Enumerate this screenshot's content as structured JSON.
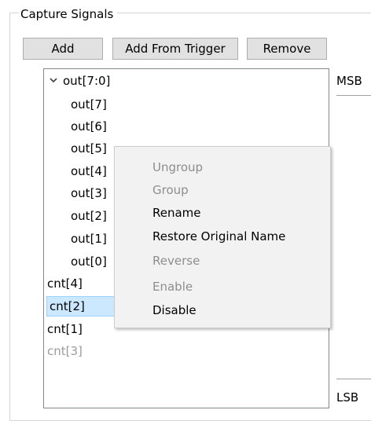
{
  "group": {
    "title": "Capture Signals"
  },
  "buttons": {
    "add": "Add",
    "add_from_trigger": "Add From Trigger",
    "remove": "Remove"
  },
  "tree": {
    "root": {
      "label": "out[7:0]",
      "expanded": true
    },
    "children": [
      {
        "label": "out[7]"
      },
      {
        "label": "out[6]"
      },
      {
        "label": "out[5]"
      },
      {
        "label": "out[4]"
      },
      {
        "label": "out[3]"
      },
      {
        "label": "out[2]"
      },
      {
        "label": "out[1]"
      },
      {
        "label": "out[0]"
      }
    ],
    "others": [
      {
        "label": "cnt[4]",
        "state": "normal"
      },
      {
        "label": "cnt[2]",
        "state": "selected"
      },
      {
        "label": "cnt[1]",
        "state": "normal"
      },
      {
        "label": "cnt[3]",
        "state": "disabled"
      }
    ]
  },
  "side": {
    "msb": "MSB",
    "lsb": "LSB"
  },
  "context_menu": {
    "items": [
      {
        "label": "Ungroup",
        "enabled": false
      },
      {
        "label": "Group",
        "enabled": false
      },
      {
        "label": "Rename",
        "enabled": true
      },
      {
        "label": "Restore Original Name",
        "enabled": true
      },
      {
        "label": "Reverse",
        "enabled": false
      },
      {
        "label": "Enable",
        "enabled": false
      },
      {
        "label": "Disable",
        "enabled": true
      }
    ]
  },
  "colors": {
    "selection_bg": "#cce8ff",
    "selection_border": "#99d1ff",
    "disabled_text": "#9b9b9b",
    "menu_bg": "#f2f2f2",
    "button_bg": "#e1e1e1"
  }
}
